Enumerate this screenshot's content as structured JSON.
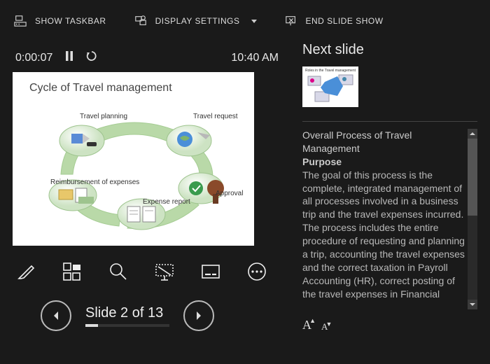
{
  "toolbar": {
    "show_taskbar": "SHOW TASKBAR",
    "display_settings": "DISPLAY SETTINGS",
    "end_show": "END SLIDE SHOW"
  },
  "time": {
    "elapsed": "0:00:07",
    "clock": "10:40 AM"
  },
  "current_slide": {
    "title": "Cycle of Travel management",
    "labels": {
      "planning": "Travel planning",
      "request": "Travel request",
      "approval": "Approval",
      "expense": "Expense report",
      "reimburse": "Reimbursement of expenses"
    }
  },
  "counter": {
    "text": "Slide 2 of 13",
    "current": 2,
    "total": 13
  },
  "next": {
    "label": "Next slide",
    "title": "Roles in the Travel management"
  },
  "notes": {
    "heading": "Overall Process of Travel Management",
    "subheading": "Purpose",
    "body": "The goal of this process is the complete, integrated management of all processes involved in a business trip and the travel expenses incurred. The process includes the entire procedure of requesting and planning a trip, accounting the travel expenses and the correct taxation in Payroll Accounting (HR), correct posting of the travel expenses in Financial"
  }
}
